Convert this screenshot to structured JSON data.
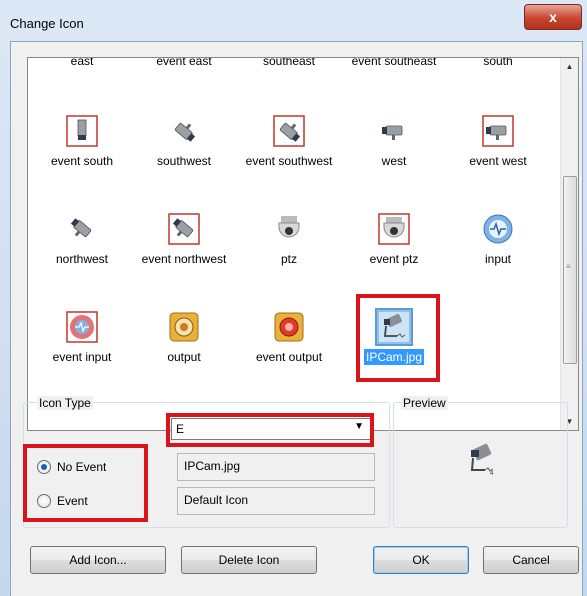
{
  "window": {
    "title": "Change Icon",
    "close_glyph": "x"
  },
  "icon_list": {
    "items": [
      {
        "label": "east",
        "icon": "none",
        "selected": false
      },
      {
        "label": "event east",
        "icon": "none",
        "selected": false
      },
      {
        "label": "southeast",
        "icon": "none",
        "selected": false
      },
      {
        "label": "event southeast",
        "icon": "none",
        "selected": false
      },
      {
        "label": "south",
        "icon": "none",
        "selected": false
      },
      {
        "label": "event south",
        "icon": "camera-south-event-icon",
        "selected": false
      },
      {
        "label": "southwest",
        "icon": "camera-southwest-icon",
        "selected": false
      },
      {
        "label": "event southwest",
        "icon": "camera-southwest-event-icon",
        "selected": false
      },
      {
        "label": "west",
        "icon": "camera-west-icon",
        "selected": false
      },
      {
        "label": "event west",
        "icon": "camera-west-event-icon",
        "selected": false
      },
      {
        "label": "northwest",
        "icon": "camera-northwest-icon",
        "selected": false
      },
      {
        "label": "event northwest",
        "icon": "camera-northwest-event-icon",
        "selected": false
      },
      {
        "label": "ptz",
        "icon": "ptz-dome-icon",
        "selected": false
      },
      {
        "label": "event ptz",
        "icon": "ptz-dome-event-icon",
        "selected": false
      },
      {
        "label": "input",
        "icon": "input-signal-icon",
        "selected": false
      },
      {
        "label": "event input",
        "icon": "event-input-icon",
        "selected": false
      },
      {
        "label": "output",
        "icon": "output-icon",
        "selected": false
      },
      {
        "label": "event output",
        "icon": "event-output-icon",
        "selected": false
      },
      {
        "label": "IPCam.jpg",
        "icon": "ipcam-image-icon",
        "selected": true
      }
    ]
  },
  "icon_type": {
    "group_label": "Icon Type",
    "combo_value": "E",
    "radio_no_event": "No Event",
    "radio_event": "Event",
    "no_event_file": "IPCam.jpg",
    "event_file": "Default Icon",
    "selected_radio": "No Event"
  },
  "preview": {
    "label": "Preview",
    "icon": "ipcam-image-icon"
  },
  "buttons": {
    "add_icon": "Add Icon...",
    "delete_icon": "Delete Icon",
    "ok": "OK",
    "cancel": "Cancel"
  },
  "colors": {
    "highlight_red": "#d9141b",
    "selection_blue": "#3399ff"
  }
}
